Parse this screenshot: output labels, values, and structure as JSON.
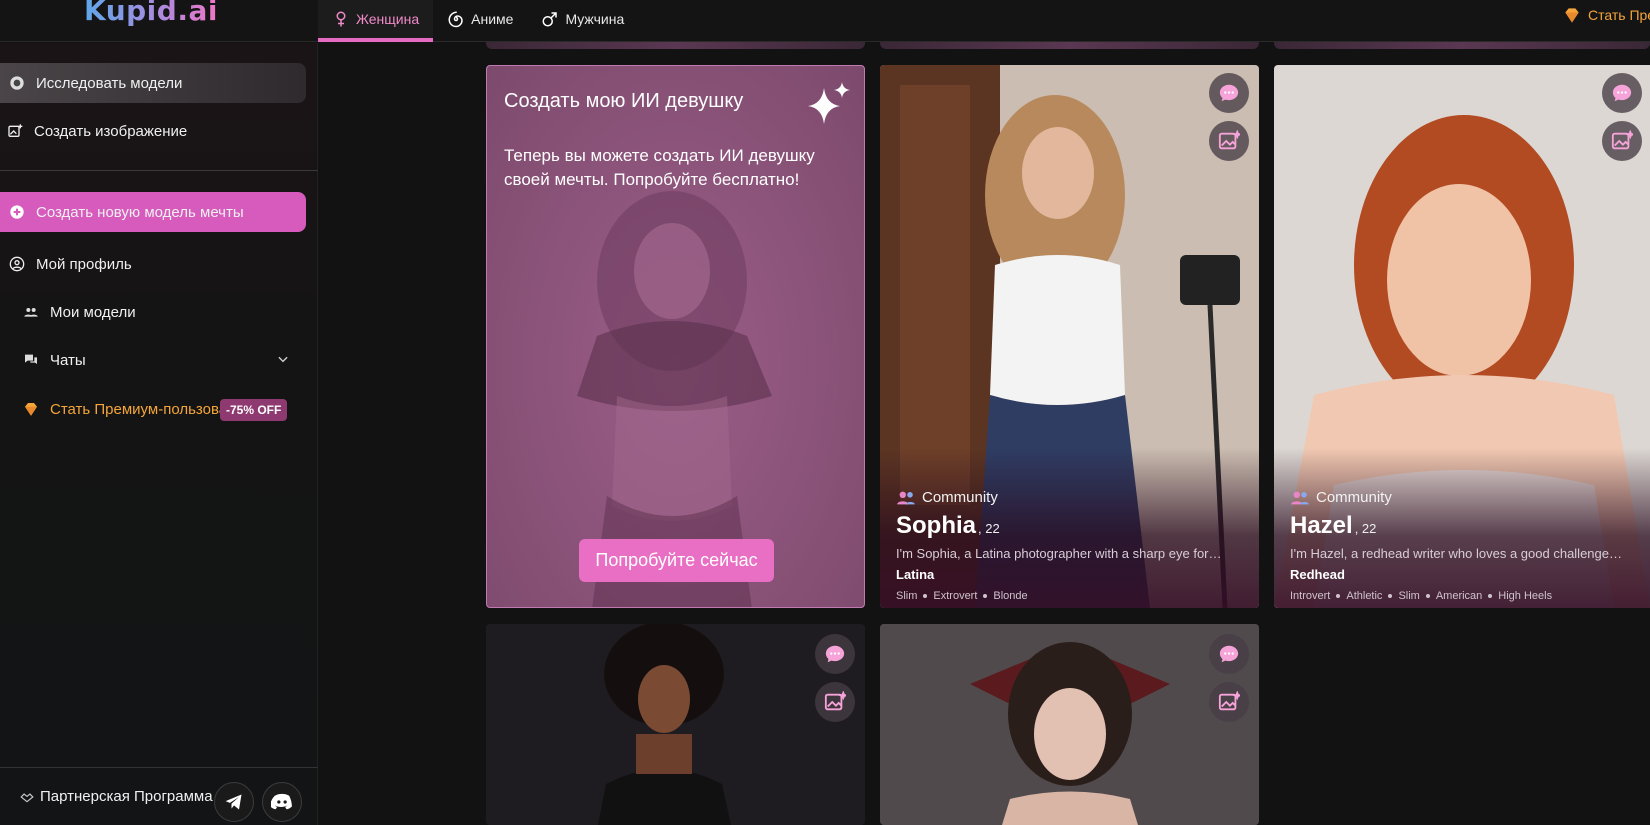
{
  "logo": "Kupid.ai",
  "tabs": [
    {
      "label": "Женщина",
      "icon": "female-icon"
    },
    {
      "label": "Аниме",
      "icon": "spiral-icon"
    },
    {
      "label": "Мужчина",
      "icon": "male-icon"
    }
  ],
  "top_premium": "Стать Премиум-пользователем",
  "sidebar": {
    "explore": "Исследовать модели",
    "create_image": "Создать изображение",
    "create_model": "Создать новую модель мечты",
    "profile": "Мой профиль",
    "my_models": "Мои модели",
    "chats": "Чаты",
    "premium": "Стать Премиум-пользователем",
    "discount": "-75% OFF",
    "partner": "Партнерская Программа"
  },
  "promo": {
    "title": "Создать мою ИИ девушку",
    "text": "Теперь вы можете создать ИИ девушку своей мечты. Попробуйте бесплатно!",
    "button": "Попробуйте сейчас"
  },
  "cards": [
    {
      "community": "Community",
      "name": "Sophia",
      "age": ", 22",
      "desc": "I'm Sophia, a Latina photographer with a sharp eye for…",
      "category": "Latina",
      "tags": [
        "Slim",
        "Extrovert",
        "Blonde"
      ]
    },
    {
      "community": "Community",
      "name": "Hazel",
      "age": ", 22",
      "desc": "I'm Hazel, a redhead writer who loves a good challenge…",
      "category": "Redhead",
      "tags": [
        "Introvert",
        "Athletic",
        "Slim",
        "American",
        "High Heels"
      ]
    }
  ],
  "colors": {
    "accent": "#e46bc1",
    "cta": "#d65bbd",
    "premium": "#f5a53a",
    "background": "#121212"
  }
}
